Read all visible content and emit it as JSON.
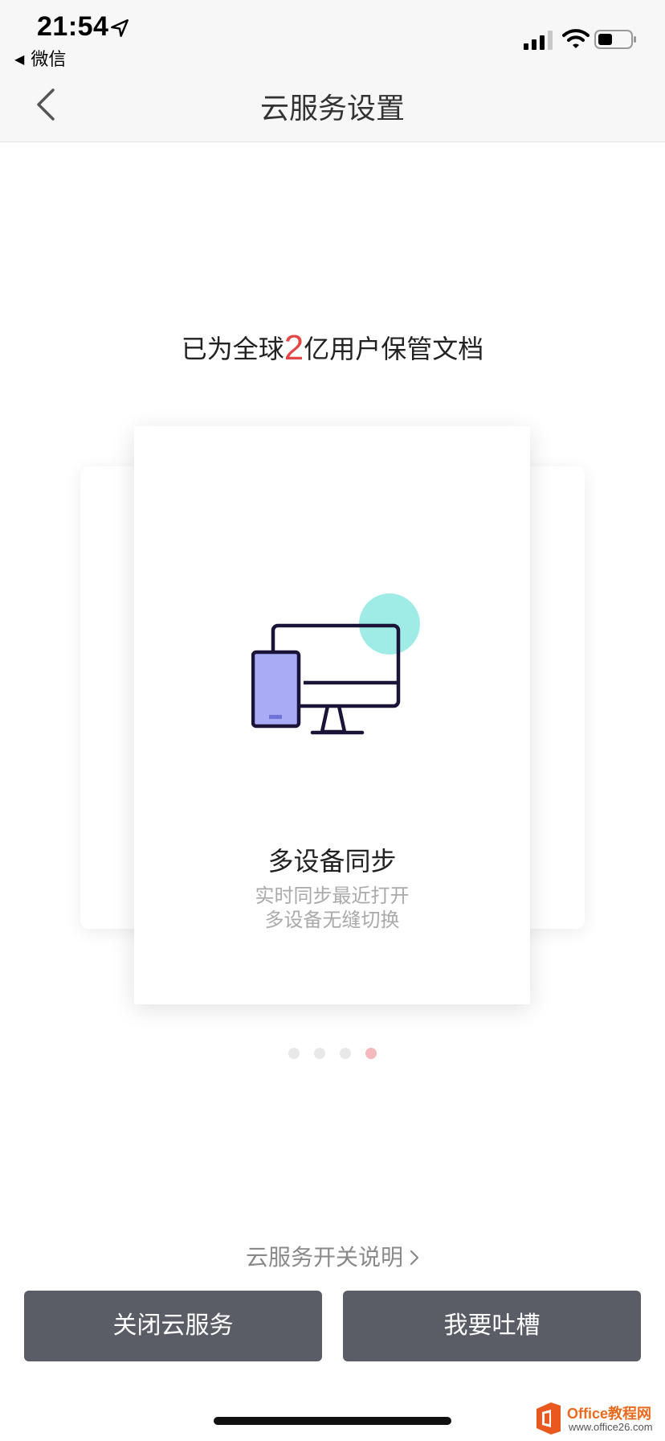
{
  "status_bar": {
    "time": "21:54",
    "back_app": "微信",
    "icons": [
      "location-arrow-icon",
      "signal-icon",
      "wifi-icon",
      "battery-icon"
    ]
  },
  "nav": {
    "title": "云服务设置",
    "back_icon": "chevron-left-icon"
  },
  "headline": {
    "prefix": "已为全球",
    "number": "2",
    "suffix": "亿用户保管文档",
    "number_color": "#e64545"
  },
  "carousel": {
    "active_card": {
      "icon": "multi-device-sync-icon",
      "title": "多设备同步",
      "subtitle_line1": "实时同步最近打开",
      "subtitle_line2": "多设备无缝切换"
    },
    "page_count": 4,
    "active_page": 4,
    "dot_color": "#e8e8e8",
    "active_dot_color": "#f4b9bd"
  },
  "footer": {
    "switch_link": "云服务开关说明",
    "close_button": "关闭云服务",
    "feedback_button": "我要吐槽",
    "button_color": "#5a5d66"
  },
  "watermark": {
    "brand": "Office教程网",
    "url": "www.office26.com"
  }
}
